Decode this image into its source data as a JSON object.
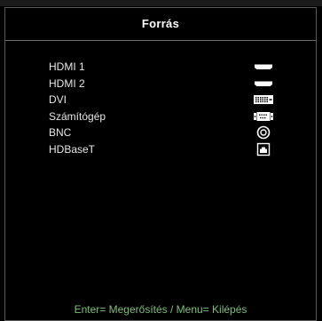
{
  "header": {
    "title": "Forrás"
  },
  "sources": [
    {
      "label": "HDMI 1",
      "icon": "hdmi-port-icon"
    },
    {
      "label": "HDMI 2",
      "icon": "hdmi-port-icon"
    },
    {
      "label": "DVI",
      "icon": "dvi-port-icon"
    },
    {
      "label": "Számítógép",
      "icon": "vga-port-icon"
    },
    {
      "label": "BNC",
      "icon": "bnc-connector-icon"
    },
    {
      "label": "HDBaseT",
      "icon": "hdbaset-port-icon"
    }
  ],
  "footer": {
    "hint": "Enter= Megerősítés / Menu= Kilépés"
  },
  "colors": {
    "background": "#000000",
    "text": "#ffffff",
    "footer_text": "#7ec07a",
    "border": "#5a5a5a"
  }
}
